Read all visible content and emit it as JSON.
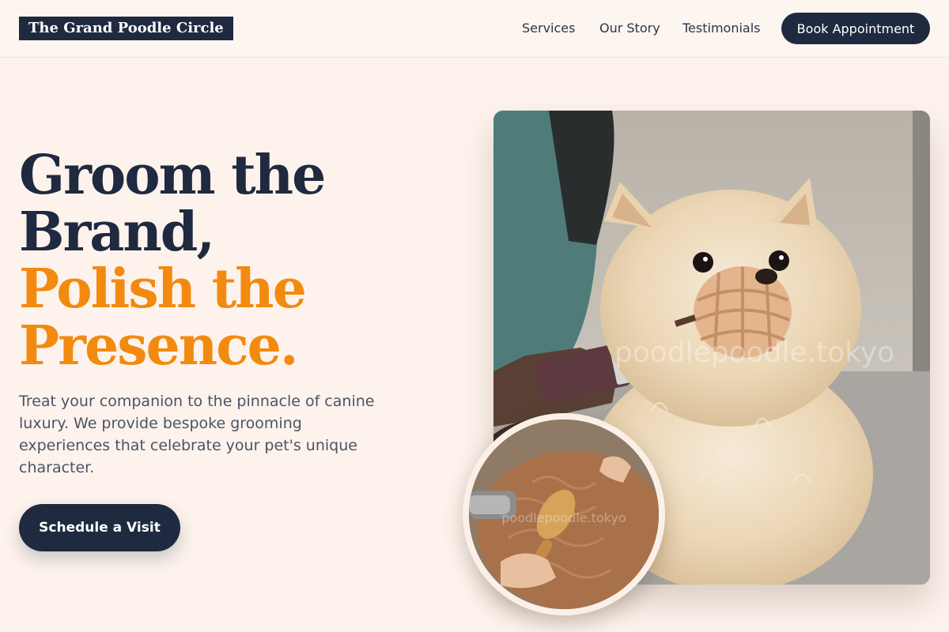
{
  "header": {
    "logo": "The Grand Poodle Circle",
    "nav": {
      "services": "Services",
      "story": "Our Story",
      "testimonials": "Testimonials"
    },
    "book_label": "Book Appointment"
  },
  "hero": {
    "heading_line1": "Groom the",
    "heading_line2": "Brand,",
    "heading_line3": "Polish the",
    "heading_line4": "Presence.",
    "subtitle": "Treat your companion to the pinnacle of canine luxury. We provide bespoke grooming experiences that celebrate your pet's unique character.",
    "cta_label": "Schedule a Visit"
  },
  "images": {
    "main_watermark": "poodlepoodle.tokyo",
    "inset_watermark": "poodlepoodle.tokyo"
  },
  "colors": {
    "background": "#fdf3ec",
    "navy": "#1f2a40",
    "accent": "#f28a0f",
    "body_text": "#4a5466"
  }
}
